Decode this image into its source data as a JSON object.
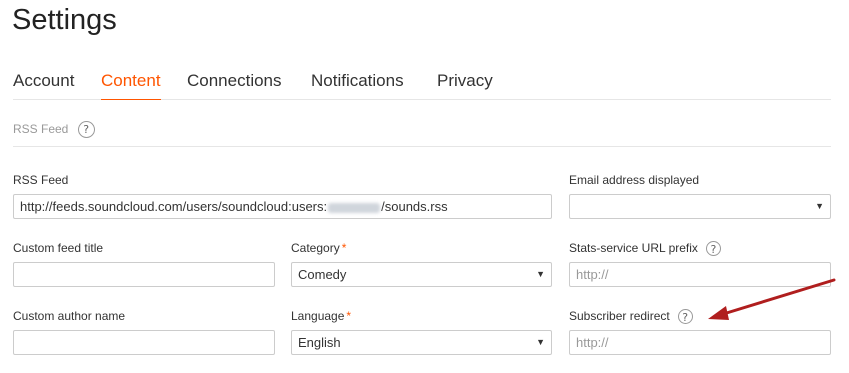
{
  "page": {
    "title": "Settings"
  },
  "tabs": [
    {
      "label": "Account",
      "active": false
    },
    {
      "label": "Content",
      "active": true
    },
    {
      "label": "Connections",
      "active": false
    },
    {
      "label": "Notifications",
      "active": false
    },
    {
      "label": "Privacy",
      "active": false
    }
  ],
  "section": {
    "title": "RSS Feed",
    "help_icon": "?"
  },
  "form": {
    "rss_feed": {
      "label": "RSS Feed",
      "value_prefix": "http://feeds.soundcloud.com/users/soundcloud:users:",
      "value_suffix": "/sounds.rss"
    },
    "email_address": {
      "label": "Email address displayed",
      "value": ""
    },
    "custom_feed_title": {
      "label": "Custom feed title",
      "value": ""
    },
    "category": {
      "label": "Category",
      "required_mark": "*",
      "value": "Comedy"
    },
    "stats_prefix": {
      "label": "Stats-service URL prefix",
      "help_icon": "?",
      "placeholder": "http://"
    },
    "custom_author": {
      "label": "Custom author name",
      "value": ""
    },
    "language": {
      "label": "Language",
      "required_mark": "*",
      "value": "English"
    },
    "subscriber_redirect": {
      "label": "Subscriber redirect",
      "help_icon": "?",
      "placeholder": "http://"
    }
  },
  "colors": {
    "accent": "#ff5500",
    "annotation_arrow": "#b01e1e"
  }
}
